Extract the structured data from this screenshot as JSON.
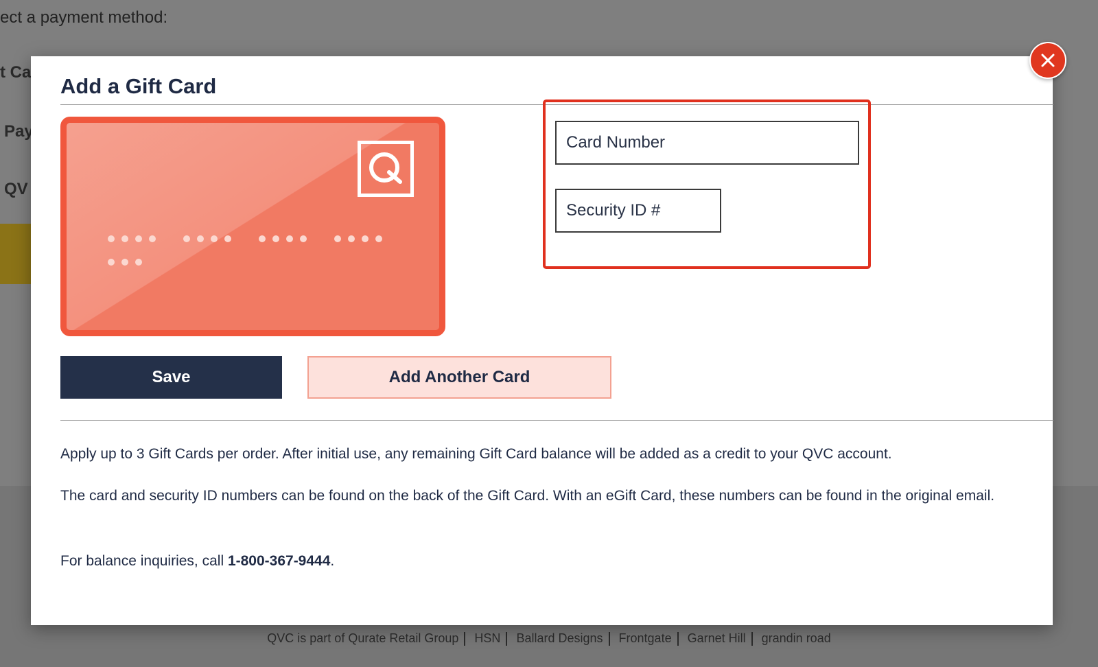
{
  "background": {
    "heading": "ect a payment method:",
    "options": [
      "t Ca",
      "Pay",
      "QV"
    ],
    "footer": {
      "items": [
        "QVC is part of Qurate Retail Group",
        "HSN",
        "Ballard Designs",
        "Frontgate",
        "Garnet Hill",
        "grandin road"
      ]
    }
  },
  "modal": {
    "title": "Add a Gift Card",
    "close_icon": "close-icon",
    "card_illustration": {
      "logo_letter": "Q",
      "masked_groups": [
        4,
        4,
        4,
        4,
        3
      ]
    },
    "fields": {
      "card_number_placeholder": "Card Number",
      "card_number_value": "",
      "security_id_placeholder": "Security ID #",
      "security_id_value": ""
    },
    "buttons": {
      "save": "Save",
      "add_another": "Add Another Card"
    },
    "info": {
      "line1": "Apply up to 3 Gift Cards per order. After initial use, any remaining Gift Card balance will be added as a credit to your QVC account.",
      "line2": "The card and security ID numbers can be found on the back of the Gift Card. With an eGift Card, these numbers can be found in the original email.",
      "line3_prefix": "For balance inquiries, call ",
      "phone": "1-800-367-9444",
      "line3_suffix": "."
    }
  },
  "colors": {
    "accent": "#e0371f",
    "navy": "#243049",
    "card": "#f17a63",
    "highlight": "#e0301e"
  }
}
